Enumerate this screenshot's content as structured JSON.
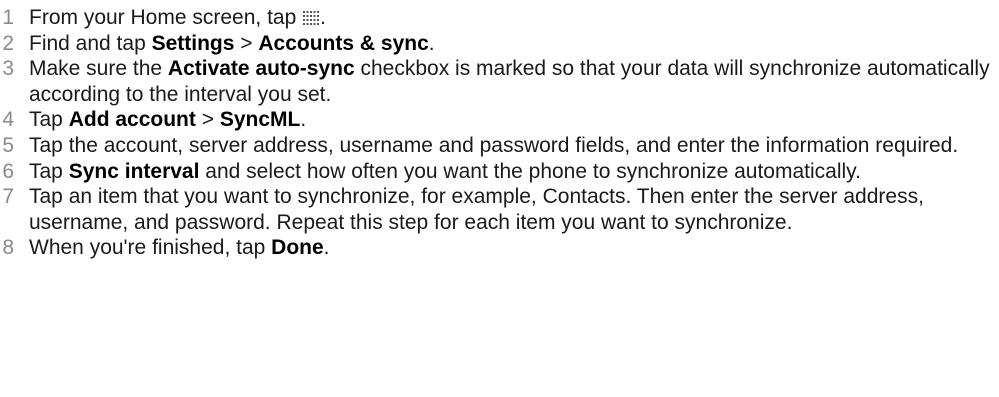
{
  "steps": [
    {
      "num": "1",
      "parts": [
        {
          "t": "From your Home screen, tap "
        },
        {
          "icon": "apps-grid-icon"
        },
        {
          "t": "."
        }
      ]
    },
    {
      "num": "2",
      "parts": [
        {
          "t": "Find and tap "
        },
        {
          "b": "Settings"
        },
        {
          "t": " > "
        },
        {
          "b": "Accounts & sync"
        },
        {
          "t": "."
        }
      ]
    },
    {
      "num": "3",
      "parts": [
        {
          "t": "Make sure the "
        },
        {
          "b": "Activate auto-sync"
        },
        {
          "t": " checkbox is marked so that your data will synchronize automatically according to the interval you set."
        }
      ]
    },
    {
      "num": "4",
      "parts": [
        {
          "t": "Tap "
        },
        {
          "b": "Add account"
        },
        {
          "t": " > "
        },
        {
          "b": "SyncML"
        },
        {
          "t": "."
        }
      ]
    },
    {
      "num": "5",
      "parts": [
        {
          "t": "Tap the account, server address, username and password fields, and enter the information required."
        }
      ]
    },
    {
      "num": "6",
      "parts": [
        {
          "t": "Tap "
        },
        {
          "b": "Sync interval"
        },
        {
          "t": " and select how often you want the phone to synchronize automatically."
        }
      ]
    },
    {
      "num": "7",
      "parts": [
        {
          "t": "Tap an item that you want to synchronize, for example, Contacts. Then enter the server address, username, and password. Repeat this step for each item you want to synchronize."
        }
      ]
    },
    {
      "num": "8",
      "parts": [
        {
          "t": "When you're finished, tap "
        },
        {
          "b": "Done"
        },
        {
          "t": "."
        }
      ]
    }
  ],
  "colors": {
    "step_number": "#8a8a8a",
    "text": "#1a1a1a"
  }
}
